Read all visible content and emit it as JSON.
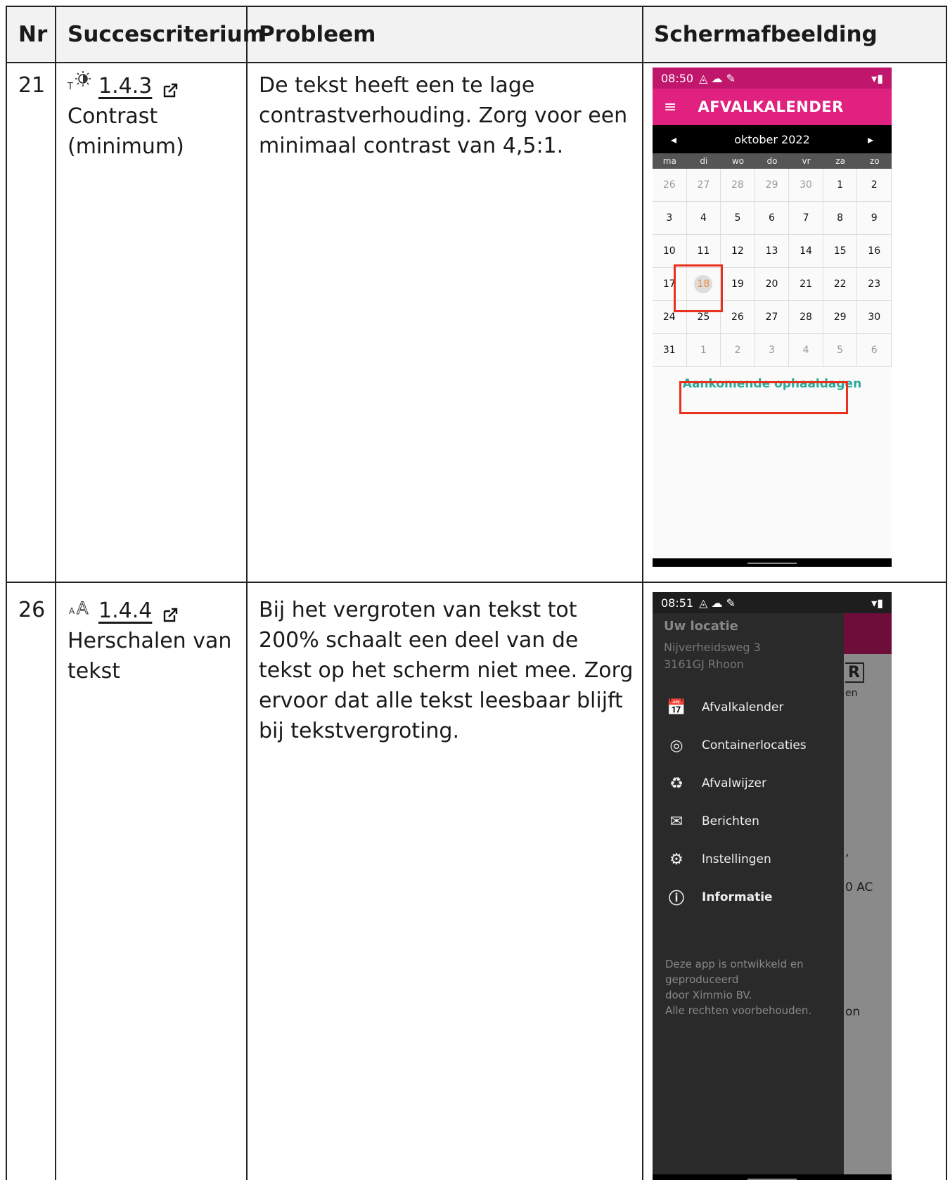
{
  "headers": {
    "nr": "Nr",
    "criterion": "Succescriterium",
    "problem": "Probleem",
    "screenshot": "Schermafbeelding"
  },
  "rows": [
    {
      "nr": "21",
      "icon": "contrast-icon",
      "code": "1.4.3",
      "criterion_name_1": "Contrast",
      "criterion_name_2": "(minimum)",
      "problem": "De tekst heeft een te lage contrastverhouding. Zorg voor een minimaal contrast van 4,5:1.",
      "phone": {
        "time": "08:50",
        "app_title": "AFVALKALENDER",
        "month": "oktober 2022",
        "weekdays": [
          "ma",
          "di",
          "wo",
          "do",
          "vr",
          "za",
          "zo"
        ],
        "days": [
          [
            "26",
            "27",
            "28",
            "29",
            "30",
            "1",
            "2"
          ],
          [
            "3",
            "4",
            "5",
            "6",
            "7",
            "8",
            "9"
          ],
          [
            "10",
            "11",
            "12",
            "13",
            "14",
            "15",
            "16"
          ],
          [
            "17",
            "18",
            "19",
            "20",
            "21",
            "22",
            "23"
          ],
          [
            "24",
            "25",
            "26",
            "27",
            "28",
            "29",
            "30"
          ],
          [
            "31",
            "1",
            "2",
            "3",
            "4",
            "5",
            "6"
          ]
        ],
        "today": "18",
        "upcoming_link": "Aankomende ophaaldagen",
        "accent_color": "#e0217f",
        "highlight_color": "#e8321e"
      }
    },
    {
      "nr": "26",
      "icon": "text-resize-icon",
      "code": "1.4.4",
      "criterion_name_1": "Herschalen van",
      "criterion_name_2": "tekst",
      "problem": "Bij het vergroten van tekst tot 200% schaalt een deel van de tekst op het scherm niet mee. Zorg ervoor dat alle tekst leesbaar blijft bij tekstvergroting.",
      "phone": {
        "time": "08:51",
        "drawer_title": "Uw locatie",
        "address_1": "Nijverheidsweg 3",
        "address_2": "3161GJ Rhoon",
        "menu": [
          {
            "label": "Afvalkalender",
            "icon": "calendar-icon",
            "glyph": "📅"
          },
          {
            "label": "Containerlocaties",
            "icon": "location-pin-icon",
            "glyph": "◎"
          },
          {
            "label": "Afvalwijzer",
            "icon": "recycle-icon",
            "glyph": "♻"
          },
          {
            "label": "Berichten",
            "icon": "mail-icon",
            "glyph": "✉"
          },
          {
            "label": "Instellingen",
            "icon": "gear-icon",
            "glyph": "⚙"
          },
          {
            "label": "Informatie",
            "icon": "info-icon",
            "glyph": "ⓘ"
          }
        ],
        "footer_1": "Deze app is ontwikkeld en",
        "footer_2": "geproduceerd",
        "footer_3": "door Ximmio BV.",
        "footer_4": "Alle rechten voorbehouden.",
        "behind_1": "R",
        "behind_2": "en",
        "behind_3": ",",
        "behind_4": "0 AC",
        "behind_5": "on"
      }
    }
  ]
}
